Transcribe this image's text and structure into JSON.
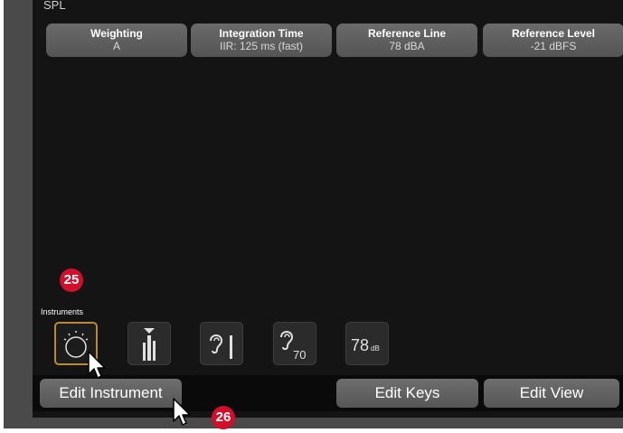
{
  "panel": {
    "title": "SPL"
  },
  "params": [
    {
      "title": "Weighting",
      "value": "A"
    },
    {
      "title": "Integration Time",
      "value": "IIR: 125 ms (fast)"
    },
    {
      "title": "Reference Line",
      "value": "78 dBA"
    },
    {
      "title": "Reference Level",
      "value": "-21 dBFS"
    }
  ],
  "instruments": {
    "label": "Instruments",
    "items": [
      {
        "name": "radial-meter-icon",
        "selected": true
      },
      {
        "name": "bar-meter-icon",
        "selected": false
      },
      {
        "name": "ear-level-icon",
        "selected": false
      },
      {
        "name": "ear-70-icon",
        "selected": false,
        "text": "70"
      },
      {
        "name": "numeric-db-icon",
        "selected": false,
        "text": "78",
        "unit": "dB"
      }
    ]
  },
  "buttons": {
    "edit_instrument": "Edit Instrument",
    "edit_keys": "Edit Keys",
    "edit_view": "Edit View"
  },
  "callouts": {
    "badge_25": "25",
    "badge_26": "26"
  },
  "colors": {
    "selected_border": "#b98a36",
    "badge": "#d0102a",
    "panel": "#141414"
  }
}
